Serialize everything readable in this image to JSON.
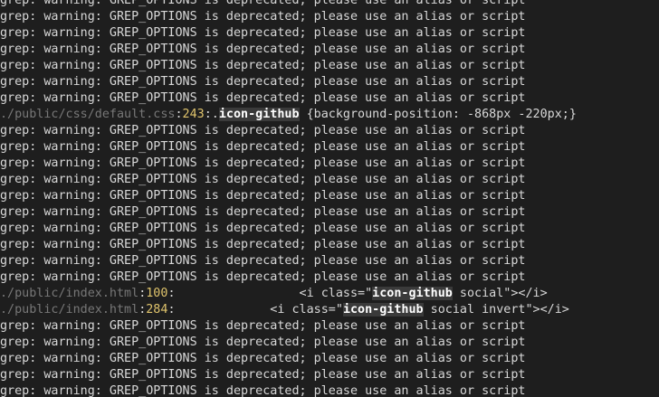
{
  "colors": {
    "background": "#1e1e1e",
    "text": "#d8d8d8",
    "path": "#777777",
    "line_number": "#e0c46c",
    "match_background": "#3a3a3a",
    "match_text": "#ffffff"
  },
  "lines": [
    {
      "segments": [
        {
          "t": "plain",
          "text": "grep: warning: GREP_OPTIONS is deprecated; please use an alias or script"
        }
      ]
    },
    {
      "segments": [
        {
          "t": "plain",
          "text": "grep: warning: GREP_OPTIONS is deprecated; please use an alias or script"
        }
      ]
    },
    {
      "segments": [
        {
          "t": "plain",
          "text": "grep: warning: GREP_OPTIONS is deprecated; please use an alias or script"
        }
      ]
    },
    {
      "segments": [
        {
          "t": "plain",
          "text": "grep: warning: GREP_OPTIONS is deprecated; please use an alias or script"
        }
      ]
    },
    {
      "segments": [
        {
          "t": "plain",
          "text": "grep: warning: GREP_OPTIONS is deprecated; please use an alias or script"
        }
      ]
    },
    {
      "segments": [
        {
          "t": "plain",
          "text": "grep: warning: GREP_OPTIONS is deprecated; please use an alias or script"
        }
      ]
    },
    {
      "segments": [
        {
          "t": "plain",
          "text": "grep: warning: GREP_OPTIONS is deprecated; please use an alias or script"
        }
      ]
    },
    {
      "segments": [
        {
          "t": "path",
          "text": "./public/css/default.css"
        },
        {
          "t": "sep",
          "text": ":"
        },
        {
          "t": "lineno",
          "text": "243"
        },
        {
          "t": "sep",
          "text": ":"
        },
        {
          "t": "plain",
          "text": "."
        },
        {
          "t": "hl",
          "text": "icon-github"
        },
        {
          "t": "plain",
          "text": " {background-position: -868px -220px;}"
        }
      ]
    },
    {
      "segments": [
        {
          "t": "plain",
          "text": "grep: warning: GREP_OPTIONS is deprecated; please use an alias or script"
        }
      ]
    },
    {
      "segments": [
        {
          "t": "plain",
          "text": "grep: warning: GREP_OPTIONS is deprecated; please use an alias or script"
        }
      ]
    },
    {
      "segments": [
        {
          "t": "plain",
          "text": "grep: warning: GREP_OPTIONS is deprecated; please use an alias or script"
        }
      ]
    },
    {
      "segments": [
        {
          "t": "plain",
          "text": "grep: warning: GREP_OPTIONS is deprecated; please use an alias or script"
        }
      ]
    },
    {
      "segments": [
        {
          "t": "plain",
          "text": "grep: warning: GREP_OPTIONS is deprecated; please use an alias or script"
        }
      ]
    },
    {
      "segments": [
        {
          "t": "plain",
          "text": "grep: warning: GREP_OPTIONS is deprecated; please use an alias or script"
        }
      ]
    },
    {
      "segments": [
        {
          "t": "plain",
          "text": "grep: warning: GREP_OPTIONS is deprecated; please use an alias or script"
        }
      ]
    },
    {
      "segments": [
        {
          "t": "plain",
          "text": "grep: warning: GREP_OPTIONS is deprecated; please use an alias or script"
        }
      ]
    },
    {
      "segments": [
        {
          "t": "plain",
          "text": "grep: warning: GREP_OPTIONS is deprecated; please use an alias or script"
        }
      ]
    },
    {
      "segments": [
        {
          "t": "plain",
          "text": "grep: warning: GREP_OPTIONS is deprecated; please use an alias or script"
        }
      ]
    },
    {
      "segments": [
        {
          "t": "path",
          "text": "./public/index.html"
        },
        {
          "t": "sep",
          "text": ":"
        },
        {
          "t": "lineno",
          "text": "100"
        },
        {
          "t": "sep",
          "text": ":"
        },
        {
          "t": "plain",
          "text": "                 <i class=\""
        },
        {
          "t": "hl",
          "text": "icon-github"
        },
        {
          "t": "plain",
          "text": " social\"></i>"
        }
      ]
    },
    {
      "segments": [
        {
          "t": "path",
          "text": "./public/index.html"
        },
        {
          "t": "sep",
          "text": ":"
        },
        {
          "t": "lineno",
          "text": "284"
        },
        {
          "t": "sep",
          "text": ":"
        },
        {
          "t": "plain",
          "text": "             <i class=\""
        },
        {
          "t": "hl",
          "text": "icon-github"
        },
        {
          "t": "plain",
          "text": " social invert\"></i>"
        }
      ]
    },
    {
      "segments": [
        {
          "t": "plain",
          "text": "grep: warning: GREP_OPTIONS is deprecated; please use an alias or script"
        }
      ]
    },
    {
      "segments": [
        {
          "t": "plain",
          "text": "grep: warning: GREP_OPTIONS is deprecated; please use an alias or script"
        }
      ]
    },
    {
      "segments": [
        {
          "t": "plain",
          "text": "grep: warning: GREP_OPTIONS is deprecated; please use an alias or script"
        }
      ]
    },
    {
      "segments": [
        {
          "t": "plain",
          "text": "grep: warning: GREP_OPTIONS is deprecated; please use an alias or script"
        }
      ]
    },
    {
      "segments": [
        {
          "t": "plain",
          "text": "grep: warning: GREP_OPTIONS is deprecated; please use an alias or script"
        }
      ]
    }
  ]
}
